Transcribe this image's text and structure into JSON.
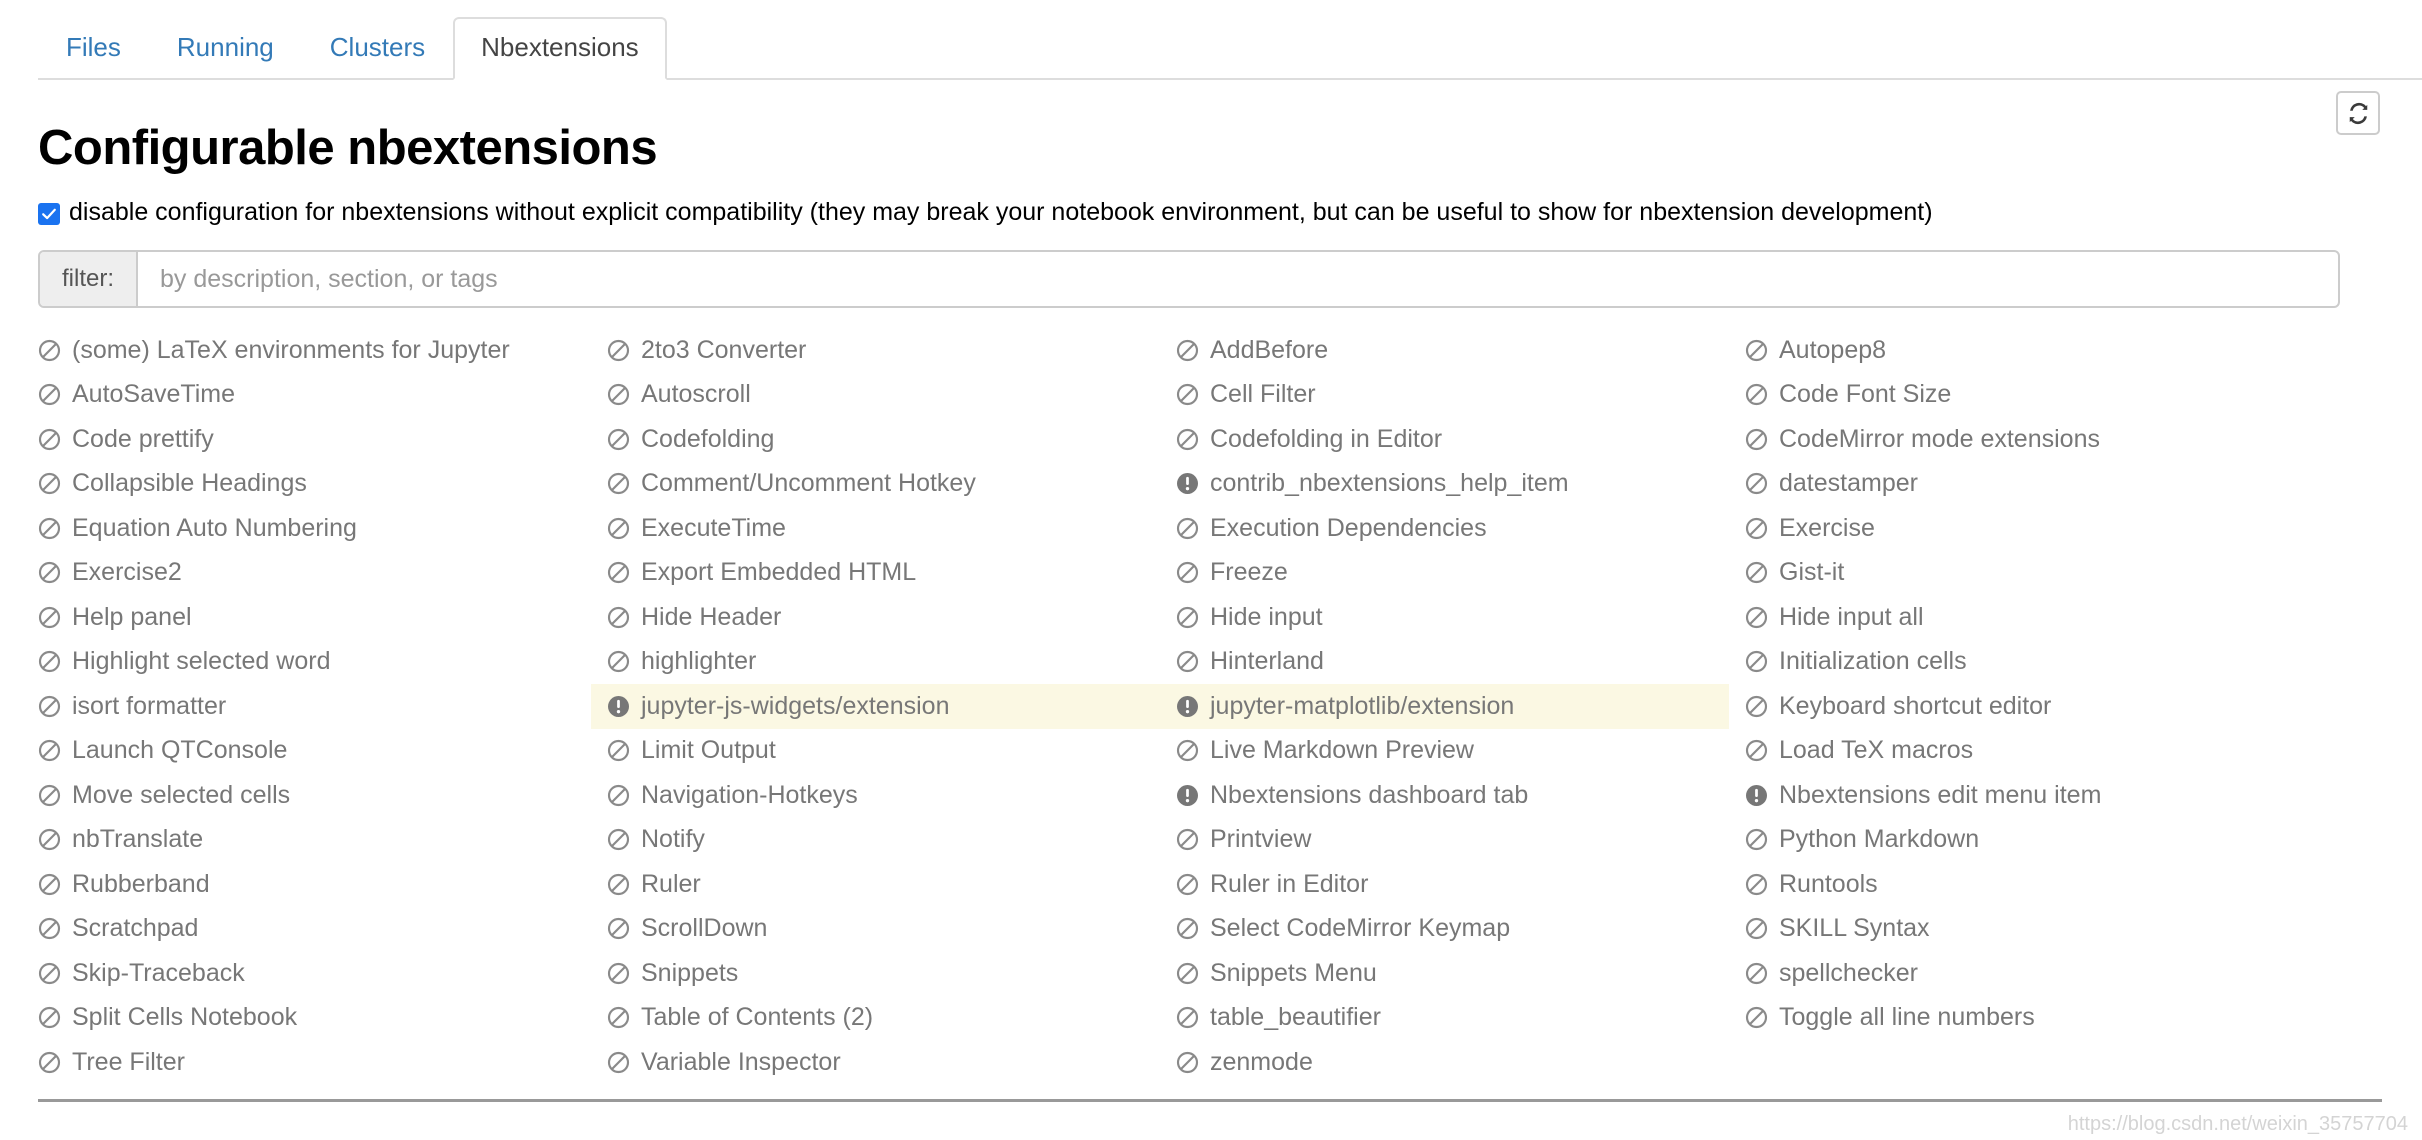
{
  "tabs": [
    {
      "label": "Files",
      "active": false
    },
    {
      "label": "Running",
      "active": false
    },
    {
      "label": "Clusters",
      "active": false
    },
    {
      "label": "Nbextensions",
      "active": true
    }
  ],
  "toolbar": {
    "refresh_icon": "refresh-icon",
    "refresh_title": "refresh"
  },
  "header": {
    "title": "Configurable nbextensions"
  },
  "config": {
    "checkbox_checked": true,
    "checkbox_label": "disable configuration for nbextensions without explicit compatibility (they may break your notebook environment, but can be useful to show for nbextension development)"
  },
  "filter": {
    "addon_label": "filter:",
    "value": "",
    "placeholder": "by description, section, or tags"
  },
  "colors": {
    "tab_link": "#337ab7",
    "tab_active_text": "#444444",
    "checkbox_accent": "#1a73f0",
    "row_highlight_bg": "#fbf8e3",
    "item_text": "#777777",
    "icon_gray": "#777777",
    "border": "#cccccc",
    "watermark": "#d4d4d4"
  },
  "extensions": {
    "icon_names": {
      "incompatible": "ban-icon",
      "warning": "exclamation-circle-icon"
    },
    "columns": [
      {
        "items": [
          {
            "label": "(some) LaTeX environments for Jupyter",
            "icon": "ban-icon",
            "highlight": false
          },
          {
            "label": "AutoSaveTime",
            "icon": "ban-icon",
            "highlight": false
          },
          {
            "label": "Code prettify",
            "icon": "ban-icon",
            "highlight": false
          },
          {
            "label": "Collapsible Headings",
            "icon": "ban-icon",
            "highlight": false
          },
          {
            "label": "Equation Auto Numbering",
            "icon": "ban-icon",
            "highlight": false
          },
          {
            "label": "Exercise2",
            "icon": "ban-icon",
            "highlight": false
          },
          {
            "label": "Help panel",
            "icon": "ban-icon",
            "highlight": false
          },
          {
            "label": "Highlight selected word",
            "icon": "ban-icon",
            "highlight": false
          },
          {
            "label": "isort formatter",
            "icon": "ban-icon",
            "highlight": false
          },
          {
            "label": "Launch QTConsole",
            "icon": "ban-icon",
            "highlight": false
          },
          {
            "label": "Move selected cells",
            "icon": "ban-icon",
            "highlight": false
          },
          {
            "label": "nbTranslate",
            "icon": "ban-icon",
            "highlight": false
          },
          {
            "label": "Rubberband",
            "icon": "ban-icon",
            "highlight": false
          },
          {
            "label": "Scratchpad",
            "icon": "ban-icon",
            "highlight": false
          },
          {
            "label": "Skip-Traceback",
            "icon": "ban-icon",
            "highlight": false
          },
          {
            "label": "Split Cells Notebook",
            "icon": "ban-icon",
            "highlight": false
          },
          {
            "label": "Tree Filter",
            "icon": "ban-icon",
            "highlight": false
          }
        ]
      },
      {
        "items": [
          {
            "label": "2to3 Converter",
            "icon": "ban-icon",
            "highlight": false
          },
          {
            "label": "Autoscroll",
            "icon": "ban-icon",
            "highlight": false
          },
          {
            "label": "Codefolding",
            "icon": "ban-icon",
            "highlight": false
          },
          {
            "label": "Comment/Uncomment Hotkey",
            "icon": "ban-icon",
            "highlight": false
          },
          {
            "label": "ExecuteTime",
            "icon": "ban-icon",
            "highlight": false
          },
          {
            "label": "Export Embedded HTML",
            "icon": "ban-icon",
            "highlight": false
          },
          {
            "label": "Hide Header",
            "icon": "ban-icon",
            "highlight": false
          },
          {
            "label": "highlighter",
            "icon": "ban-icon",
            "highlight": false
          },
          {
            "label": "jupyter-js-widgets/extension",
            "icon": "exclamation-circle-icon",
            "highlight": true
          },
          {
            "label": "Limit Output",
            "icon": "ban-icon",
            "highlight": false
          },
          {
            "label": "Navigation-Hotkeys",
            "icon": "ban-icon",
            "highlight": false
          },
          {
            "label": "Notify",
            "icon": "ban-icon",
            "highlight": false
          },
          {
            "label": "Ruler",
            "icon": "ban-icon",
            "highlight": false
          },
          {
            "label": "ScrollDown",
            "icon": "ban-icon",
            "highlight": false
          },
          {
            "label": "Snippets",
            "icon": "ban-icon",
            "highlight": false
          },
          {
            "label": "Table of Contents (2)",
            "icon": "ban-icon",
            "highlight": false
          },
          {
            "label": "Variable Inspector",
            "icon": "ban-icon",
            "highlight": false
          }
        ]
      },
      {
        "items": [
          {
            "label": "AddBefore",
            "icon": "ban-icon",
            "highlight": false
          },
          {
            "label": "Cell Filter",
            "icon": "ban-icon",
            "highlight": false
          },
          {
            "label": "Codefolding in Editor",
            "icon": "ban-icon",
            "highlight": false
          },
          {
            "label": "contrib_nbextensions_help_item",
            "icon": "exclamation-circle-icon",
            "highlight": false
          },
          {
            "label": "Execution Dependencies",
            "icon": "ban-icon",
            "highlight": false
          },
          {
            "label": "Freeze",
            "icon": "ban-icon",
            "highlight": false
          },
          {
            "label": "Hide input",
            "icon": "ban-icon",
            "highlight": false
          },
          {
            "label": "Hinterland",
            "icon": "ban-icon",
            "highlight": false
          },
          {
            "label": "jupyter-matplotlib/extension",
            "icon": "exclamation-circle-icon",
            "highlight": true
          },
          {
            "label": "Live Markdown Preview",
            "icon": "ban-icon",
            "highlight": false
          },
          {
            "label": "Nbextensions dashboard tab",
            "icon": "exclamation-circle-icon",
            "highlight": false
          },
          {
            "label": "Printview",
            "icon": "ban-icon",
            "highlight": false
          },
          {
            "label": "Ruler in Editor",
            "icon": "ban-icon",
            "highlight": false
          },
          {
            "label": "Select CodeMirror Keymap",
            "icon": "ban-icon",
            "highlight": false
          },
          {
            "label": "Snippets Menu",
            "icon": "ban-icon",
            "highlight": false
          },
          {
            "label": "table_beautifier",
            "icon": "ban-icon",
            "highlight": false
          },
          {
            "label": "zenmode",
            "icon": "ban-icon",
            "highlight": false
          }
        ]
      },
      {
        "items": [
          {
            "label": "Autopep8",
            "icon": "ban-icon",
            "highlight": false
          },
          {
            "label": "Code Font Size",
            "icon": "ban-icon",
            "highlight": false
          },
          {
            "label": "CodeMirror mode extensions",
            "icon": "ban-icon",
            "highlight": false
          },
          {
            "label": "datestamper",
            "icon": "ban-icon",
            "highlight": false
          },
          {
            "label": "Exercise",
            "icon": "ban-icon",
            "highlight": false
          },
          {
            "label": "Gist-it",
            "icon": "ban-icon",
            "highlight": false
          },
          {
            "label": "Hide input all",
            "icon": "ban-icon",
            "highlight": false
          },
          {
            "label": "Initialization cells",
            "icon": "ban-icon",
            "highlight": false
          },
          {
            "label": "Keyboard shortcut editor",
            "icon": "ban-icon",
            "highlight": false
          },
          {
            "label": "Load TeX macros",
            "icon": "ban-icon",
            "highlight": false
          },
          {
            "label": "Nbextensions edit menu item",
            "icon": "exclamation-circle-icon",
            "highlight": false
          },
          {
            "label": "Python Markdown",
            "icon": "ban-icon",
            "highlight": false
          },
          {
            "label": "Runtools",
            "icon": "ban-icon",
            "highlight": false
          },
          {
            "label": "SKILL Syntax",
            "icon": "ban-icon",
            "highlight": false
          },
          {
            "label": "spellchecker",
            "icon": "ban-icon",
            "highlight": false
          },
          {
            "label": "Toggle all line numbers",
            "icon": "ban-icon",
            "highlight": false
          }
        ]
      }
    ]
  },
  "footer": {
    "watermark": "https://blog.csdn.net/weixin_35757704"
  }
}
